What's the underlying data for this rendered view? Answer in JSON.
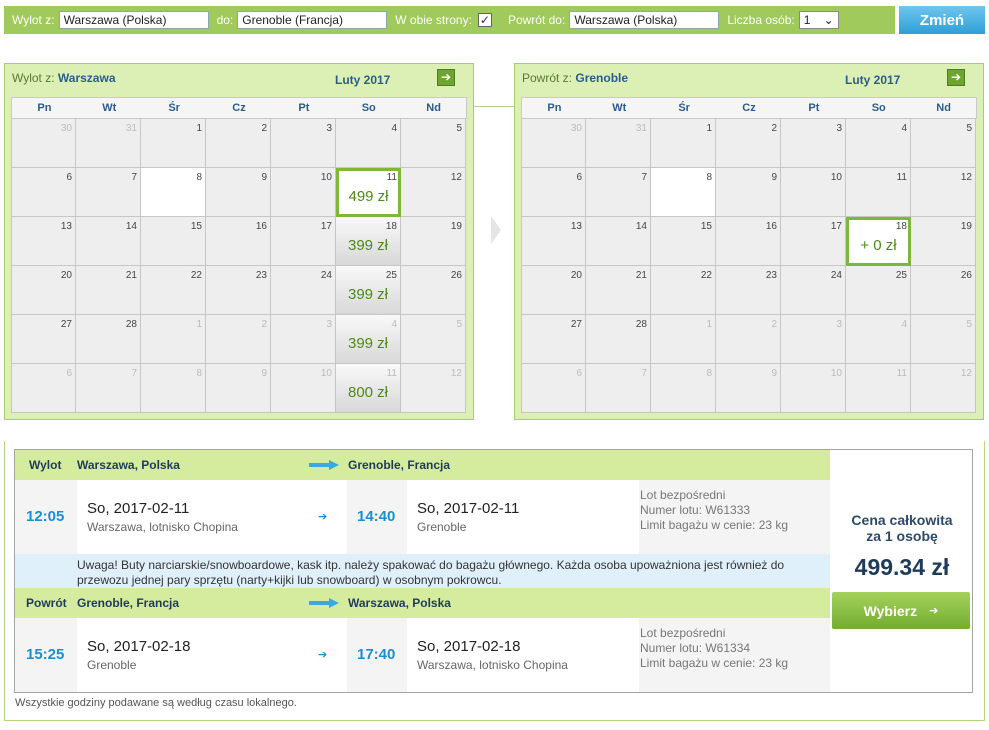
{
  "search": {
    "from_label": "Wylot z:",
    "from_value": "Warszawa (Polska)",
    "to_label": "do:",
    "to_value": "Grenoble (Francja)",
    "round_label": "W obie strony:",
    "round_checked": "✓",
    "return_label": "Powrót do:",
    "return_value": "Warszawa (Polska)",
    "persons_label": "Liczba osób:",
    "persons_value": "1",
    "change_button": "Zmień"
  },
  "weekdays": [
    "Pn",
    "Wt",
    "Śr",
    "Cz",
    "Pt",
    "So",
    "Nd"
  ],
  "outbound_calendar": {
    "from_label": "Wylot z:",
    "from_city": "Warszawa",
    "month": "Luty 2017",
    "weeks": [
      [
        {
          "d": "30",
          "t": "off"
        },
        {
          "d": "31",
          "t": "off"
        },
        {
          "d": "1",
          "t": "n"
        },
        {
          "d": "2",
          "t": "n"
        },
        {
          "d": "3",
          "t": "n"
        },
        {
          "d": "4",
          "t": "n"
        },
        {
          "d": "5",
          "t": "n"
        }
      ],
      [
        {
          "d": "6",
          "t": "n"
        },
        {
          "d": "7",
          "t": "n"
        },
        {
          "d": "8",
          "t": "blank"
        },
        {
          "d": "9",
          "t": "n"
        },
        {
          "d": "10",
          "t": "n"
        },
        {
          "d": "11",
          "t": "sel",
          "p": "499 zł"
        },
        {
          "d": "12",
          "t": "n"
        }
      ],
      [
        {
          "d": "13",
          "t": "n"
        },
        {
          "d": "14",
          "t": "n"
        },
        {
          "d": "15",
          "t": "n"
        },
        {
          "d": "16",
          "t": "n"
        },
        {
          "d": "17",
          "t": "n"
        },
        {
          "d": "18",
          "t": "avail",
          "p": "399 zł"
        },
        {
          "d": "19",
          "t": "n"
        }
      ],
      [
        {
          "d": "20",
          "t": "n"
        },
        {
          "d": "21",
          "t": "n"
        },
        {
          "d": "22",
          "t": "n"
        },
        {
          "d": "23",
          "t": "n"
        },
        {
          "d": "24",
          "t": "n"
        },
        {
          "d": "25",
          "t": "avail",
          "p": "399 zł"
        },
        {
          "d": "26",
          "t": "n"
        }
      ],
      [
        {
          "d": "27",
          "t": "n"
        },
        {
          "d": "28",
          "t": "n"
        },
        {
          "d": "1",
          "t": "off"
        },
        {
          "d": "2",
          "t": "off"
        },
        {
          "d": "3",
          "t": "off"
        },
        {
          "d": "4",
          "t": "avail off",
          "p": "399 zł"
        },
        {
          "d": "5",
          "t": "off"
        }
      ],
      [
        {
          "d": "6",
          "t": "off"
        },
        {
          "d": "7",
          "t": "off"
        },
        {
          "d": "8",
          "t": "off"
        },
        {
          "d": "9",
          "t": "off"
        },
        {
          "d": "10",
          "t": "off"
        },
        {
          "d": "11",
          "t": "avail off",
          "p": "800 zł"
        },
        {
          "d": "12",
          "t": "off"
        }
      ]
    ]
  },
  "return_calendar": {
    "from_label": "Powrót z:",
    "from_city": "Grenoble",
    "month": "Luty 2017",
    "weeks": [
      [
        {
          "d": "30",
          "t": "off"
        },
        {
          "d": "31",
          "t": "off"
        },
        {
          "d": "1",
          "t": "n"
        },
        {
          "d": "2",
          "t": "n"
        },
        {
          "d": "3",
          "t": "n"
        },
        {
          "d": "4",
          "t": "n"
        },
        {
          "d": "5",
          "t": "n"
        }
      ],
      [
        {
          "d": "6",
          "t": "n"
        },
        {
          "d": "7",
          "t": "n"
        },
        {
          "d": "8",
          "t": "blank"
        },
        {
          "d": "9",
          "t": "n"
        },
        {
          "d": "10",
          "t": "n"
        },
        {
          "d": "11",
          "t": "n"
        },
        {
          "d": "12",
          "t": "n"
        }
      ],
      [
        {
          "d": "13",
          "t": "n"
        },
        {
          "d": "14",
          "t": "n"
        },
        {
          "d": "15",
          "t": "n"
        },
        {
          "d": "16",
          "t": "n"
        },
        {
          "d": "17",
          "t": "n"
        },
        {
          "d": "18",
          "t": "sel",
          "p": "+ 0 zł"
        },
        {
          "d": "19",
          "t": "n"
        }
      ],
      [
        {
          "d": "20",
          "t": "n"
        },
        {
          "d": "21",
          "t": "n"
        },
        {
          "d": "22",
          "t": "n"
        },
        {
          "d": "23",
          "t": "n"
        },
        {
          "d": "24",
          "t": "n"
        },
        {
          "d": "25",
          "t": "n"
        },
        {
          "d": "26",
          "t": "n"
        }
      ],
      [
        {
          "d": "27",
          "t": "n"
        },
        {
          "d": "28",
          "t": "n"
        },
        {
          "d": "1",
          "t": "off"
        },
        {
          "d": "2",
          "t": "off"
        },
        {
          "d": "3",
          "t": "off"
        },
        {
          "d": "4",
          "t": "off"
        },
        {
          "d": "5",
          "t": "off"
        }
      ],
      [
        {
          "d": "6",
          "t": "off"
        },
        {
          "d": "7",
          "t": "off"
        },
        {
          "d": "8",
          "t": "off"
        },
        {
          "d": "9",
          "t": "off"
        },
        {
          "d": "10",
          "t": "off"
        },
        {
          "d": "11",
          "t": "off"
        },
        {
          "d": "12",
          "t": "off"
        }
      ]
    ]
  },
  "outbound": {
    "label": "Wylot",
    "from": "Warszawa, Polska",
    "to": "Grenoble, Francja",
    "dep_time": "12:05",
    "dep_date": "So, 2017-02-11",
    "dep_place": "Warszawa, lotnisko Chopina",
    "arr_time": "14:40",
    "arr_date": "So, 2017-02-11",
    "arr_place": "Grenoble",
    "info1": "Lot bezpośredni",
    "info2": "Numer lotu: W61333",
    "info3": "Limit bagażu w cenie: 23 kg"
  },
  "note": "Uwaga! Buty narciarskie/snowboardowe, kask itp. należy spakować do bagażu głównego. Każda osoba upoważniona jest również do przewozu jednej pary sprzętu (narty+kijki lub snowboard) w osobnym pokrowcu.",
  "inbound": {
    "label": "Powrót",
    "from": "Grenoble, Francja",
    "to": "Warszawa, Polska",
    "dep_time": "15:25",
    "dep_date": "So, 2017-02-18",
    "dep_place": "Grenoble",
    "arr_time": "17:40",
    "arr_date": "So, 2017-02-18",
    "arr_place": "Warszawa, lotnisko Chopina",
    "info1": "Lot bezpośredni",
    "info2": "Numer lotu: W61334",
    "info3": "Limit bagażu w cenie: 23 kg"
  },
  "price": {
    "title": "Cena całkowita za 1 osobę",
    "value": "499.34 zł",
    "button": "Wybierz"
  },
  "footnote": "Wszystkie godziny podawane są według czasu lokalnego.",
  "colors": {
    "accent_green": "#a0ca5b",
    "price_green": "#4c8a1c",
    "time_blue": "#1a8fd0",
    "change_blue": "#2e9fd6"
  }
}
